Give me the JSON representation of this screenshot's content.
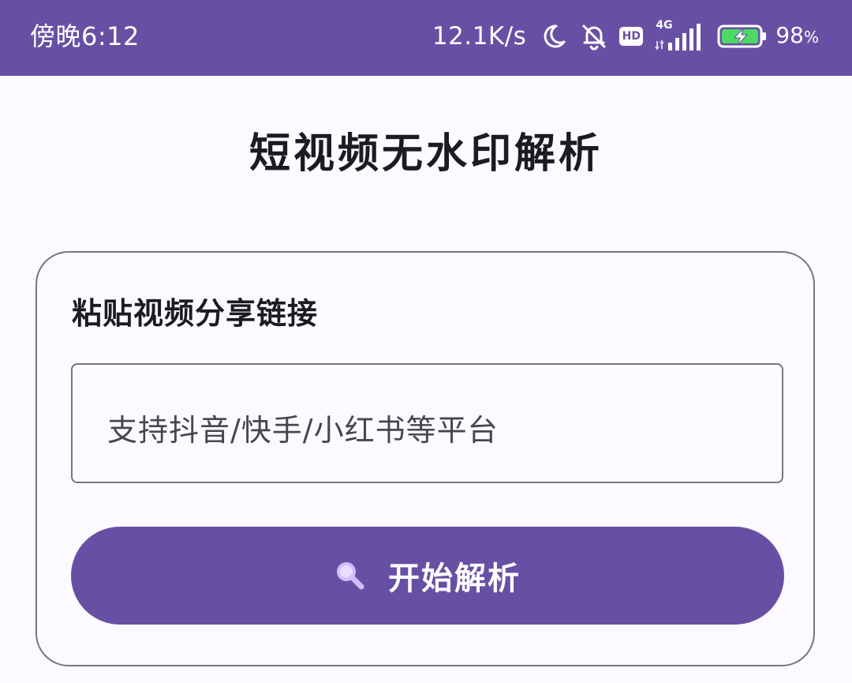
{
  "status_bar": {
    "time": "傍晚6:12",
    "net_speed": "12.1K/s",
    "hd_badge": "HD",
    "network_type": "4G",
    "battery_percent": "98",
    "battery_percent_sign": "%",
    "battery_charging": true,
    "battery_level": 0.98,
    "icons": [
      "moon-icon",
      "bell-off-icon",
      "hd-icon",
      "signal-4g-icon",
      "battery-charging-icon"
    ],
    "background_color": "#6750A4"
  },
  "page": {
    "title": "短视频无水印解析",
    "background_color": "#FDFAFF"
  },
  "card": {
    "label": "粘贴视频分享链接",
    "input": {
      "value": "",
      "placeholder": "支持抖音/快手/小红书等平台"
    },
    "button": {
      "label": "开始解析",
      "icon": "search-icon",
      "color": "#6750A4"
    }
  }
}
